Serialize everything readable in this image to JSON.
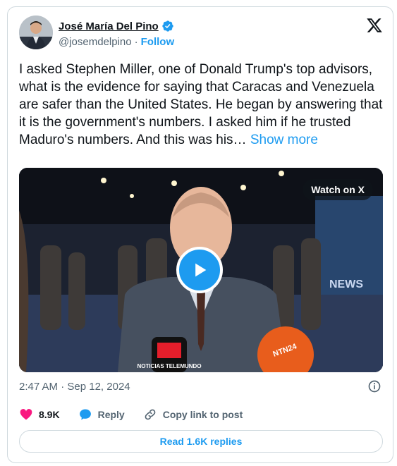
{
  "author": {
    "name": "José María Del Pino",
    "handle": "@josemdelpino",
    "follow_label": "Follow",
    "verified": true
  },
  "tweet": {
    "text": "I asked Stephen Miller, one of Donald Trump's top advisors, what is the evidence for saying that Caracas and Venezuela are safer than the United States. He began by answering that it is the government's numbers. I asked him if he trusted Maduro's numbers. And this was his…",
    "show_more_label": "Show more"
  },
  "media": {
    "watch_label": "Watch on X",
    "mic_left_text": "NOTICIAS TELEMUNDO",
    "mic_right_text": "NTN24",
    "backdrop_text": "NEWS"
  },
  "meta": {
    "time": "2:47 AM",
    "separator": "·",
    "date": "Sep 12, 2024"
  },
  "actions": {
    "likes": "8.9K",
    "reply_label": "Reply",
    "copy_label": "Copy link to post"
  },
  "replies_button": "Read 1.6K replies",
  "colors": {
    "accent": "#1d9bf0",
    "like": "#f91880",
    "text": "#0f1419",
    "secondary": "#536471"
  }
}
